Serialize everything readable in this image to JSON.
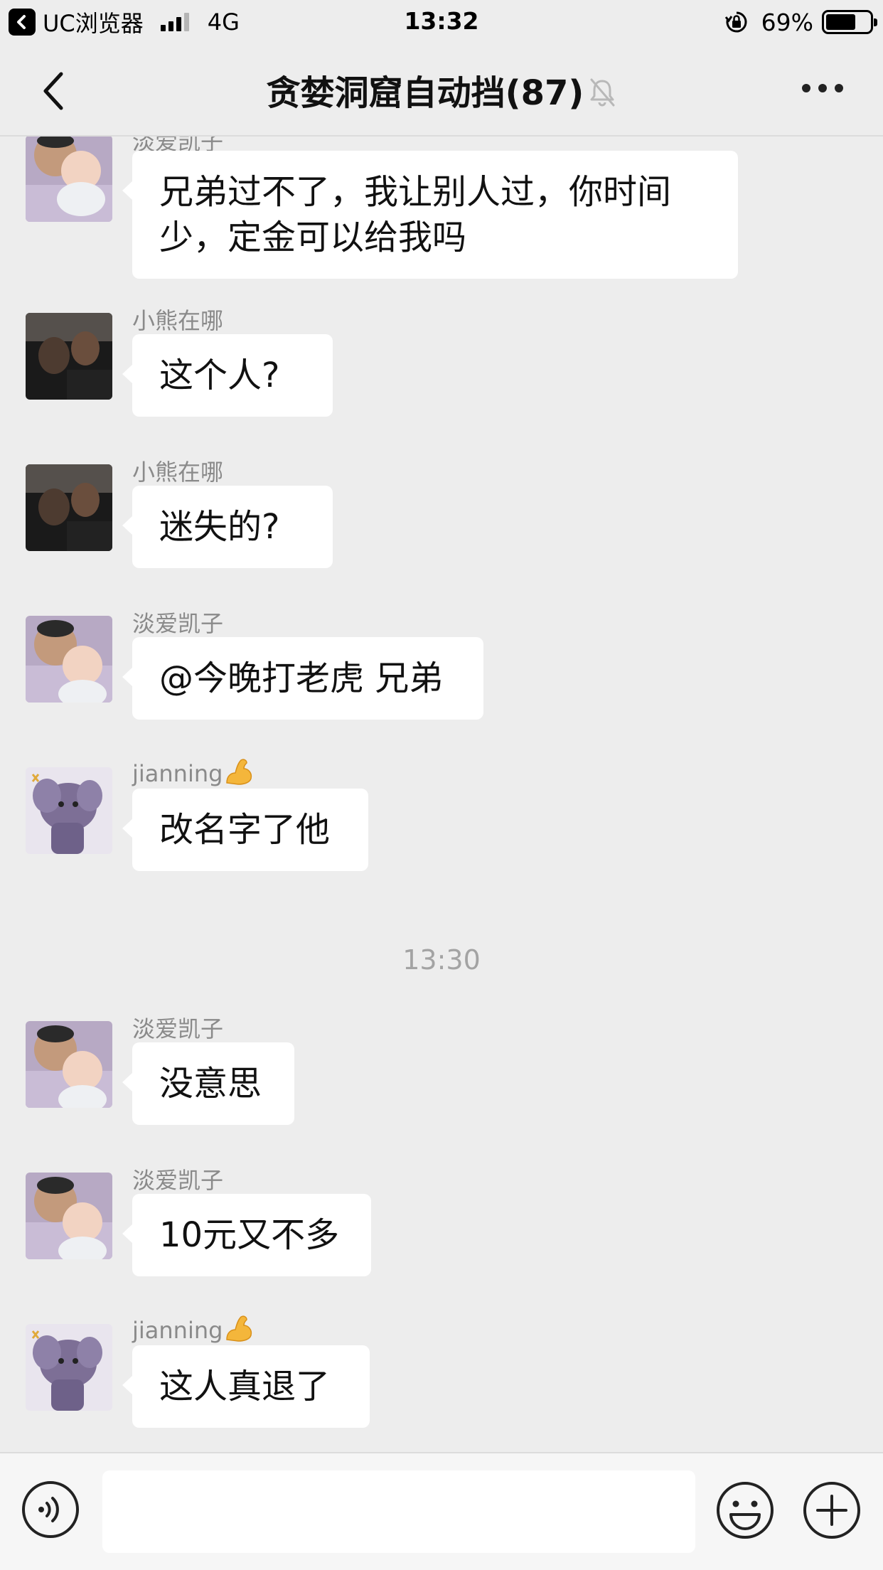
{
  "status_bar": {
    "back_app_label": "UC浏览器",
    "network": "4G",
    "time": "13:32",
    "battery_percent": "69%",
    "battery_level": 0.69,
    "signal_bars_filled": 3,
    "signal_bars_total": 4
  },
  "nav": {
    "title": "贪婪洞窟自动挡(87)",
    "back_icon": "chevron-left-icon",
    "muted_icon": "bell-muted-icon",
    "more_icon": "more-dots-icon"
  },
  "messages": [
    {
      "sender": "淡爱凯子",
      "avatar": "avatar-man-baby",
      "text": "兄弟过不了，我让别人过，你时间少，定金可以给我吗"
    },
    {
      "sender": "小熊在哪",
      "avatar": "avatar-dark-selfie",
      "text": "这个人?"
    },
    {
      "sender": "小熊在哪",
      "avatar": "avatar-dark-selfie",
      "text": "迷失的?"
    },
    {
      "sender": "淡爱凯子",
      "avatar": "avatar-man-baby",
      "text": "@今晚打老虎 兄弟"
    },
    {
      "sender": "jianning",
      "sender_emoji": "flexed-biceps",
      "avatar": "avatar-cartoon-elephant",
      "text": "改名字了他"
    },
    {
      "sender": "淡爱凯子",
      "avatar": "avatar-man-baby",
      "text": "没意思"
    },
    {
      "sender": "淡爱凯子",
      "avatar": "avatar-man-baby",
      "text": "10元又不多"
    },
    {
      "sender": "jianning",
      "sender_emoji": "flexed-biceps",
      "avatar": "avatar-cartoon-elephant",
      "text": "这人真退了"
    }
  ],
  "timestamp": "13:30",
  "input_bar": {
    "voice_icon": "voice-icon",
    "text_value": "",
    "emoji_icon": "emoji-icon",
    "plus_icon": "plus-icon"
  },
  "colors": {
    "background": "#ededed",
    "bubble": "#ffffff",
    "sender_name": "#8a8a8a",
    "timestamp": "#a3a3a3"
  }
}
